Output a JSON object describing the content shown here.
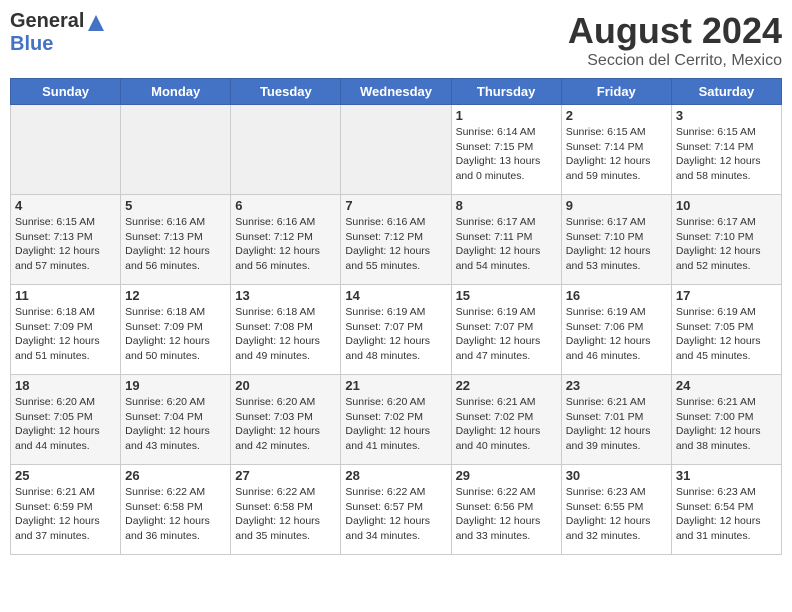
{
  "header": {
    "logo_general": "General",
    "logo_blue": "Blue",
    "title": "August 2024",
    "subtitle": "Seccion del Cerrito, Mexico"
  },
  "weekdays": [
    "Sunday",
    "Monday",
    "Tuesday",
    "Wednesday",
    "Thursday",
    "Friday",
    "Saturday"
  ],
  "weeks": [
    [
      {
        "day": "",
        "text": ""
      },
      {
        "day": "",
        "text": ""
      },
      {
        "day": "",
        "text": ""
      },
      {
        "day": "",
        "text": ""
      },
      {
        "day": "1",
        "text": "Sunrise: 6:14 AM\nSunset: 7:15 PM\nDaylight: 13 hours\nand 0 minutes."
      },
      {
        "day": "2",
        "text": "Sunrise: 6:15 AM\nSunset: 7:14 PM\nDaylight: 12 hours\nand 59 minutes."
      },
      {
        "day": "3",
        "text": "Sunrise: 6:15 AM\nSunset: 7:14 PM\nDaylight: 12 hours\nand 58 minutes."
      }
    ],
    [
      {
        "day": "4",
        "text": "Sunrise: 6:15 AM\nSunset: 7:13 PM\nDaylight: 12 hours\nand 57 minutes."
      },
      {
        "day": "5",
        "text": "Sunrise: 6:16 AM\nSunset: 7:13 PM\nDaylight: 12 hours\nand 56 minutes."
      },
      {
        "day": "6",
        "text": "Sunrise: 6:16 AM\nSunset: 7:12 PM\nDaylight: 12 hours\nand 56 minutes."
      },
      {
        "day": "7",
        "text": "Sunrise: 6:16 AM\nSunset: 7:12 PM\nDaylight: 12 hours\nand 55 minutes."
      },
      {
        "day": "8",
        "text": "Sunrise: 6:17 AM\nSunset: 7:11 PM\nDaylight: 12 hours\nand 54 minutes."
      },
      {
        "day": "9",
        "text": "Sunrise: 6:17 AM\nSunset: 7:10 PM\nDaylight: 12 hours\nand 53 minutes."
      },
      {
        "day": "10",
        "text": "Sunrise: 6:17 AM\nSunset: 7:10 PM\nDaylight: 12 hours\nand 52 minutes."
      }
    ],
    [
      {
        "day": "11",
        "text": "Sunrise: 6:18 AM\nSunset: 7:09 PM\nDaylight: 12 hours\nand 51 minutes."
      },
      {
        "day": "12",
        "text": "Sunrise: 6:18 AM\nSunset: 7:09 PM\nDaylight: 12 hours\nand 50 minutes."
      },
      {
        "day": "13",
        "text": "Sunrise: 6:18 AM\nSunset: 7:08 PM\nDaylight: 12 hours\nand 49 minutes."
      },
      {
        "day": "14",
        "text": "Sunrise: 6:19 AM\nSunset: 7:07 PM\nDaylight: 12 hours\nand 48 minutes."
      },
      {
        "day": "15",
        "text": "Sunrise: 6:19 AM\nSunset: 7:07 PM\nDaylight: 12 hours\nand 47 minutes."
      },
      {
        "day": "16",
        "text": "Sunrise: 6:19 AM\nSunset: 7:06 PM\nDaylight: 12 hours\nand 46 minutes."
      },
      {
        "day": "17",
        "text": "Sunrise: 6:19 AM\nSunset: 7:05 PM\nDaylight: 12 hours\nand 45 minutes."
      }
    ],
    [
      {
        "day": "18",
        "text": "Sunrise: 6:20 AM\nSunset: 7:05 PM\nDaylight: 12 hours\nand 44 minutes."
      },
      {
        "day": "19",
        "text": "Sunrise: 6:20 AM\nSunset: 7:04 PM\nDaylight: 12 hours\nand 43 minutes."
      },
      {
        "day": "20",
        "text": "Sunrise: 6:20 AM\nSunset: 7:03 PM\nDaylight: 12 hours\nand 42 minutes."
      },
      {
        "day": "21",
        "text": "Sunrise: 6:20 AM\nSunset: 7:02 PM\nDaylight: 12 hours\nand 41 minutes."
      },
      {
        "day": "22",
        "text": "Sunrise: 6:21 AM\nSunset: 7:02 PM\nDaylight: 12 hours\nand 40 minutes."
      },
      {
        "day": "23",
        "text": "Sunrise: 6:21 AM\nSunset: 7:01 PM\nDaylight: 12 hours\nand 39 minutes."
      },
      {
        "day": "24",
        "text": "Sunrise: 6:21 AM\nSunset: 7:00 PM\nDaylight: 12 hours\nand 38 minutes."
      }
    ],
    [
      {
        "day": "25",
        "text": "Sunrise: 6:21 AM\nSunset: 6:59 PM\nDaylight: 12 hours\nand 37 minutes."
      },
      {
        "day": "26",
        "text": "Sunrise: 6:22 AM\nSunset: 6:58 PM\nDaylight: 12 hours\nand 36 minutes."
      },
      {
        "day": "27",
        "text": "Sunrise: 6:22 AM\nSunset: 6:58 PM\nDaylight: 12 hours\nand 35 minutes."
      },
      {
        "day": "28",
        "text": "Sunrise: 6:22 AM\nSunset: 6:57 PM\nDaylight: 12 hours\nand 34 minutes."
      },
      {
        "day": "29",
        "text": "Sunrise: 6:22 AM\nSunset: 6:56 PM\nDaylight: 12 hours\nand 33 minutes."
      },
      {
        "day": "30",
        "text": "Sunrise: 6:23 AM\nSunset: 6:55 PM\nDaylight: 12 hours\nand 32 minutes."
      },
      {
        "day": "31",
        "text": "Sunrise: 6:23 AM\nSunset: 6:54 PM\nDaylight: 12 hours\nand 31 minutes."
      }
    ]
  ]
}
